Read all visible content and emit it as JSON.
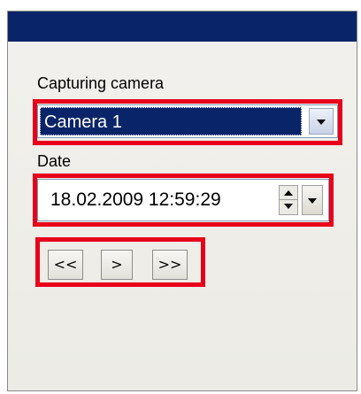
{
  "window": {
    "title": ""
  },
  "camera": {
    "label": "Capturing camera",
    "selected": "Camera 1"
  },
  "date": {
    "label": "Date",
    "value": "18.02.2009 12:59:29"
  },
  "navigation": {
    "first_label": "<<",
    "next_label": ">",
    "last_label": ">>"
  },
  "colors": {
    "titlebar": "#0a246a",
    "highlight_box": "#e8001a",
    "selection": "#0a246a"
  },
  "icons": [
    "chevron-down-icon",
    "spin-up-icon",
    "spin-down-icon"
  ]
}
